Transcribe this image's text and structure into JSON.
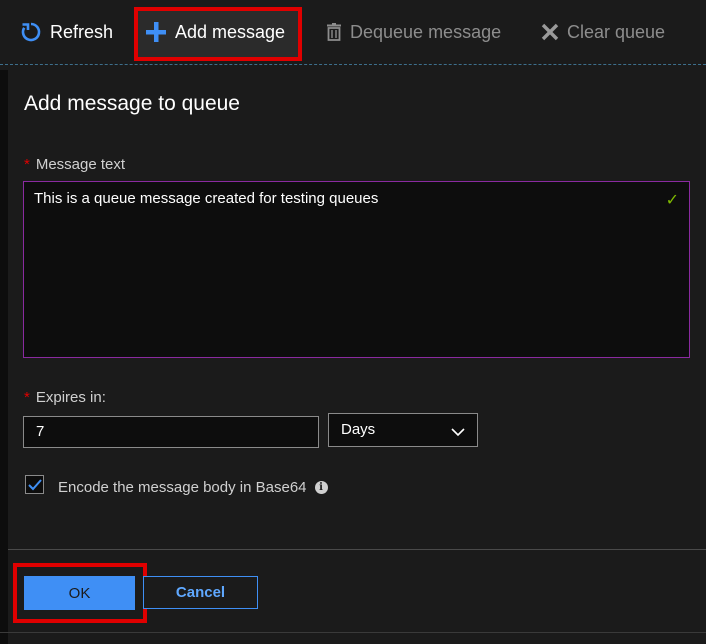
{
  "toolbar": {
    "refresh_label": "Refresh",
    "add_message_label": "Add message",
    "dequeue_label": "Dequeue message",
    "clear_label": "Clear queue"
  },
  "form": {
    "title": "Add message to queue",
    "message_label": "Message text",
    "message_value": "This is a queue message created for  testing queues",
    "expires_label": "Expires in:",
    "expires_value": "7",
    "expires_unit": "Days",
    "encode_label": "Encode the message body in Base64",
    "encode_checked": true,
    "required_marker": "*"
  },
  "actions": {
    "ok_label": "OK",
    "cancel_label": "Cancel"
  },
  "colors": {
    "accent": "#3f8ff5",
    "highlight": "#e00000",
    "focus_border": "#8a2aa0",
    "valid": "#7fba00"
  },
  "icons": {
    "refresh": "refresh-icon",
    "add": "plus-icon",
    "dequeue": "trash-icon",
    "clear": "close-icon",
    "valid": "check-icon",
    "dropdown": "chevron-down-icon",
    "info": "info-icon"
  }
}
